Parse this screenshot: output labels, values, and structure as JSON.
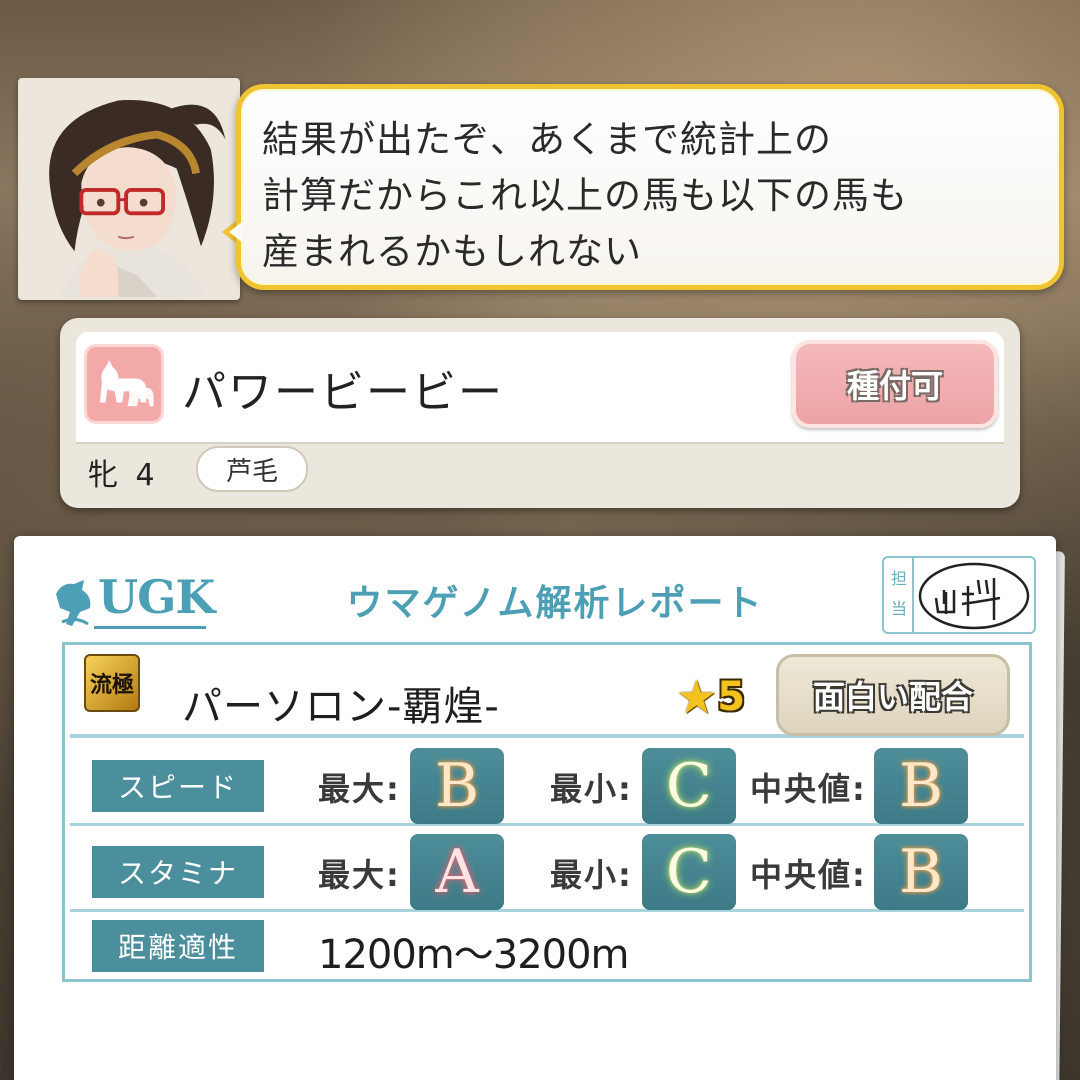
{
  "dialog": {
    "lines": [
      "結果が出たぞ、あくまで統計上の",
      "計算だからこれ以上の馬も以下の馬も",
      "産まれるかもしれない"
    ]
  },
  "horse": {
    "name": "パワービービー",
    "breed_button_label": "種付可",
    "sex": "牝",
    "age": "4",
    "coat": "芦毛"
  },
  "report": {
    "logo_text": "UGK",
    "title": "ウマゲノム解析レポート",
    "stamp_label": "担当",
    "stamp_signature": "山料",
    "pairing": {
      "icon_text": "流極",
      "name": "パーソロン-覇煌-",
      "star_symbol": "★",
      "star_value": "5",
      "evaluation": "面白い配合"
    },
    "stats": [
      {
        "label": "スピード",
        "max_key": "最大:",
        "max": "B",
        "min_key": "最小:",
        "min": "C",
        "median_key": "中央値:",
        "median": "B"
      },
      {
        "label": "スタミナ",
        "max_key": "最大:",
        "max": "A",
        "min_key": "最小:",
        "min": "C",
        "median_key": "中央値:",
        "median": "B"
      }
    ],
    "distance": {
      "label": "距離適性",
      "value": "1200m〜3200m"
    }
  },
  "colors": {
    "bubble_border": "#f0c430",
    "accent_teal": "#4c8f9c",
    "report_blue": "#4c9fb4",
    "breed_button": "#eca3a5",
    "star": "#f4c21d"
  }
}
